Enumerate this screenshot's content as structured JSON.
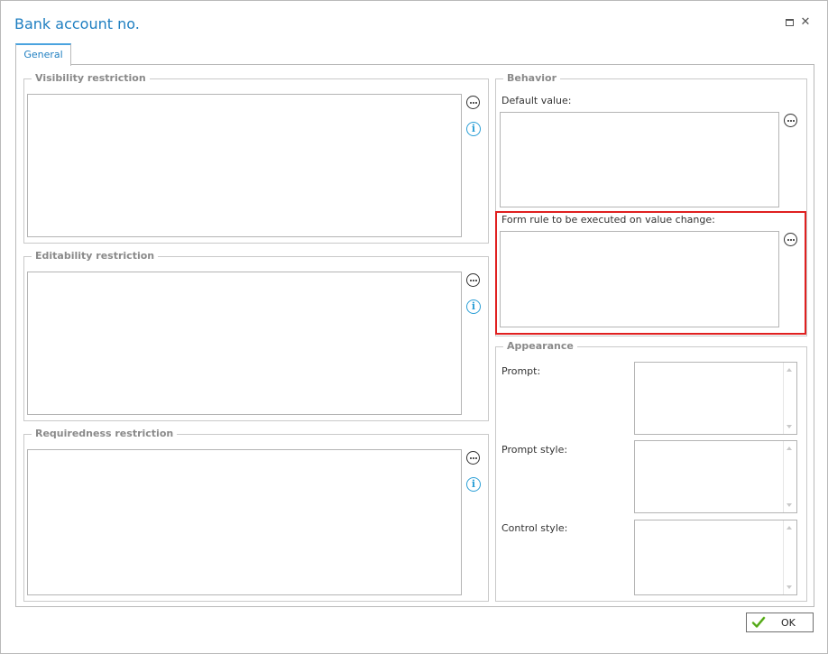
{
  "window": {
    "title": "Bank account no.",
    "maximize_icon": "maximize-icon",
    "close_glyph": "✕"
  },
  "tabs": [
    {
      "label": "General",
      "active": true
    }
  ],
  "left": {
    "visibility": {
      "legend": "Visibility restriction"
    },
    "editability": {
      "legend": "Editability restriction"
    },
    "requiredness": {
      "legend": "Requiredness restriction"
    }
  },
  "behavior": {
    "legend": "Behavior",
    "default_value_label": "Default value:",
    "form_rule_label": "Form rule to be executed on value change:"
  },
  "appearance": {
    "legend": "Appearance",
    "prompt_label": "Prompt:",
    "prompt_style_label": "Prompt style:",
    "control_style_label": "Control style:"
  },
  "footer": {
    "ok_label": "OK"
  },
  "icons": {
    "more": "ellipsis-circle-icon",
    "info": "info-icon",
    "check": "check-icon"
  },
  "colors": {
    "title": "#1f7fc1",
    "highlight": "#e02020",
    "info": "#2b9fd6",
    "check": "#6cbf2a"
  }
}
